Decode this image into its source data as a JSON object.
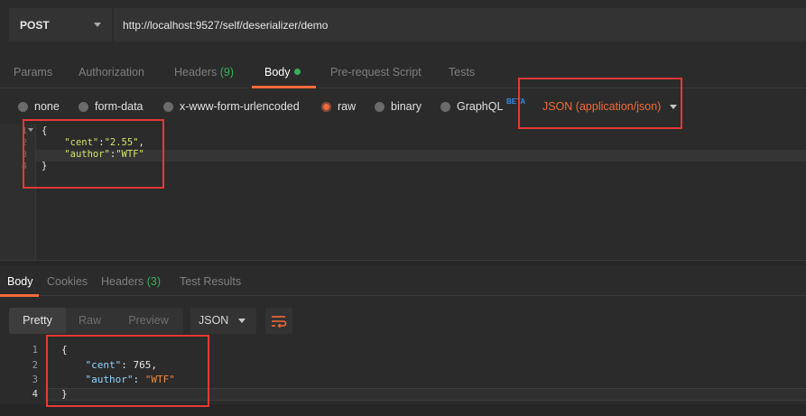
{
  "request": {
    "method": "POST",
    "url": "http://localhost:9527/self/deserializer/demo"
  },
  "request_tabs": [
    {
      "label": "Params"
    },
    {
      "label": "Authorization"
    },
    {
      "label": "Headers",
      "count": "(9)"
    },
    {
      "label": "Body",
      "active": true
    },
    {
      "label": "Pre-request Script"
    },
    {
      "label": "Tests"
    }
  ],
  "body_modes": [
    {
      "label": "none"
    },
    {
      "label": "form-data"
    },
    {
      "label": "x-www-form-urlencoded"
    },
    {
      "label": "raw",
      "selected": true
    },
    {
      "label": "binary"
    },
    {
      "label": "GraphQL",
      "badge": "BETA"
    }
  ],
  "content_type": "JSON (application/json)",
  "request_body": {
    "line_numbers": [
      "1",
      "2",
      "3",
      "4"
    ],
    "lines": [
      {
        "text": "{"
      },
      {
        "indent": "    ",
        "key": "\"cent\"",
        "sep": ":",
        "value": "\"2.55\"",
        "end": ","
      },
      {
        "indent": "    ",
        "key": "\"author\"",
        "sep": ":",
        "value": "\"WTF\"",
        "end": ""
      },
      {
        "text": "}"
      }
    ]
  },
  "response_tabs": [
    {
      "label": "Body",
      "active": true
    },
    {
      "label": "Cookies"
    },
    {
      "label": "Headers",
      "count": "(3)"
    },
    {
      "label": "Test Results"
    }
  ],
  "response_view": {
    "modes": [
      "Pretty",
      "Raw",
      "Preview"
    ],
    "active": "Pretty",
    "format": "JSON"
  },
  "response_body": {
    "line_numbers": [
      "1",
      "2",
      "3",
      "4"
    ],
    "lines": [
      {
        "text": "{"
      },
      {
        "indent": "    ",
        "key": "\"cent\"",
        "sep": ": ",
        "value": "765",
        "end": ","
      },
      {
        "indent": "    ",
        "key": "\"author\"",
        "sep": ": ",
        "value": "\"WTF\"",
        "end": ""
      },
      {
        "text": "}"
      }
    ]
  },
  "colors": {
    "accent": "#f26b3a",
    "count_green": "#35b05b",
    "highlight_red": "#e53935",
    "beta_blue": "#3a8ee6"
  }
}
